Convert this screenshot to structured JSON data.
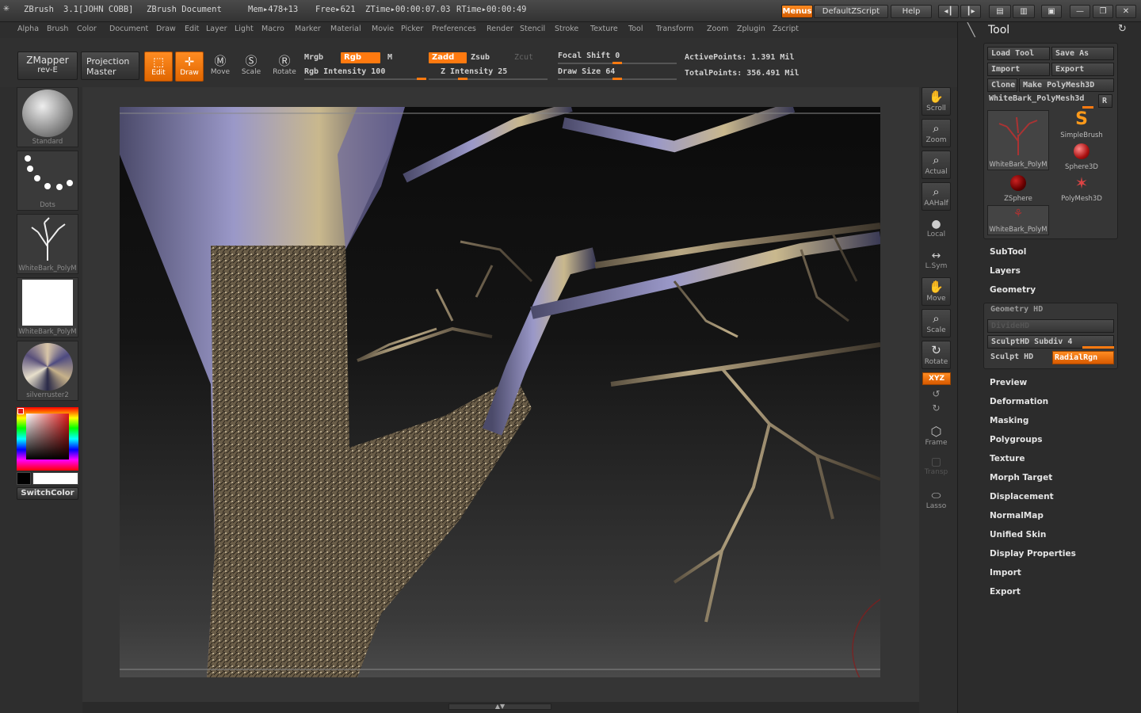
{
  "title": {
    "app": "ZBrush",
    "version": "3.1[JOHN COBB]",
    "document": "ZBrush Document",
    "mem": "Mem▸478+13",
    "free": "Free▸621",
    "ztime": "ZTime▸00:00:07.03",
    "rtime": "RTime▸00:00:49",
    "menus_btn": "Menus",
    "script_btn": "DefaultZScript",
    "help_btn": "Help"
  },
  "menu": [
    "Alpha",
    "Brush",
    "Color",
    "Document",
    "Draw",
    "Edit",
    "Layer",
    "Light",
    "Macro",
    "Marker",
    "Material",
    "Movie",
    "Picker",
    "Preferences",
    "Render",
    "Stencil",
    "Stroke",
    "Texture",
    "Tool",
    "Transform",
    "Zoom",
    "Zplugin",
    "Zscript"
  ],
  "toolbar": {
    "zmapper_line1": "ZMapper",
    "zmapper_line2": "rev-E",
    "projection_line1": "Projection",
    "projection_line2": "Master",
    "edit": "Edit",
    "draw": "Draw",
    "move": "Move",
    "scale": "Scale",
    "rotate": "Rotate",
    "mrgb": "Mrgb",
    "rgb": "Rgb",
    "m": "M",
    "rgb_intensity": "Rgb Intensity 100",
    "zadd": "Zadd",
    "zsub": "Zsub",
    "zcut": "Zcut",
    "z_intensity": "Z Intensity 25",
    "focal_shift": "Focal Shift 0",
    "draw_size": "Draw Size 64",
    "active_points": "ActivePoints: 1.391  Mil",
    "total_points": "TotalPoints: 356.491  Mil"
  },
  "left_shelf": {
    "brush": "Standard",
    "stroke": "Dots",
    "tool": "WhiteBark_PolyM",
    "texture": "WhiteBark_PolyM",
    "material": "silverruster2",
    "switch_color": "SwitchColor"
  },
  "right_shelf": {
    "scroll": "Scroll",
    "zoom": "Zoom",
    "actual": "Actual",
    "aahalf": "AAHalf",
    "local": "Local",
    "lsym": "L.Sym",
    "move": "Move",
    "scale": "Scale",
    "rotate": "Rotate",
    "xyz": "XYZ",
    "frame": "Frame",
    "transp": "Transp",
    "lasso": "Lasso"
  },
  "tool_palette": {
    "title": "Tool",
    "load_tool": "Load Tool",
    "save_as": "Save As",
    "import": "Import",
    "export": "Export",
    "clone": "Clone",
    "make_polymesh": "Make PolyMesh3D",
    "current_tool": "WhiteBark_PolyMesh3d",
    "r": "R",
    "thumbs": [
      "WhiteBark_PolyM",
      "SimpleBrush",
      "Sphere3D",
      "ZSphere",
      "PolyMesh3D",
      "WhiteBark_PolyM"
    ],
    "subtool": "SubTool",
    "layers": "Layers",
    "geometry": "Geometry",
    "geometry_hd": "Geometry HD",
    "dividehd": "DivideHD",
    "sculpthd_subdiv": "SculptHD Subdiv 4",
    "sculpt_hd": "Sculpt HD",
    "radialrgn": "RadialRgn",
    "sections": [
      "Preview",
      "Deformation",
      "Masking",
      "Polygroups",
      "Texture",
      "Morph Target",
      "Displacement",
      "NormalMap",
      "Unified Skin",
      "Display Properties",
      "Import",
      "Export"
    ]
  },
  "colors": {
    "accent": "#ff7a10",
    "bg": "#2a2a2a"
  }
}
